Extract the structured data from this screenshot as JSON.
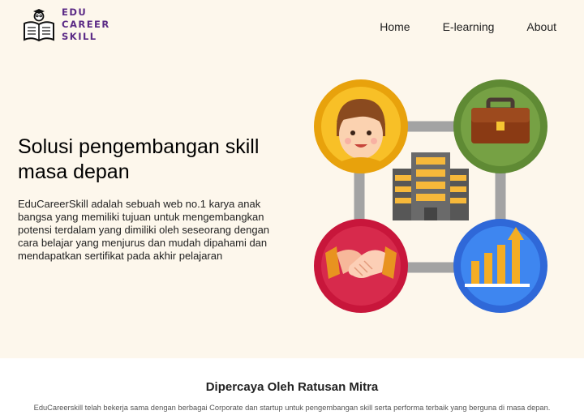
{
  "brand": {
    "lines": [
      "EDU",
      "CAREER",
      "SKILL"
    ],
    "color": "#5b2a86",
    "icon": "book-with-graduate-icon"
  },
  "nav": {
    "items": [
      {
        "label": "Home"
      },
      {
        "label": "E-learning"
      },
      {
        "label": "About"
      }
    ]
  },
  "hero": {
    "title": "Solusi pengembangan skill masa depan",
    "description": "EduCareerSkill adalah sebuah web no.1 karya anak bangsa yang memiliki tujuan untuk mengembangkan potensi terdalam yang dimiliki oleh seseorang dengan cara belajar yang menjurus dan mudah dipahami dan mendapatkan sertifikat pada akhir pelajaran",
    "background": "#fdf7ec",
    "illustration_icons": [
      "person-avatar-icon",
      "briefcase-icon",
      "office-building-icon",
      "handshake-icon",
      "growth-chart-icon"
    ]
  },
  "partners": {
    "title": "Dipercaya Oleh Ratusan Mitra",
    "description": "EduCareerskill telah bekerja sama dengan berbagai Corporate dan startup untuk pengembangan skill serta performa terbaik yang berguna di masa depan."
  }
}
